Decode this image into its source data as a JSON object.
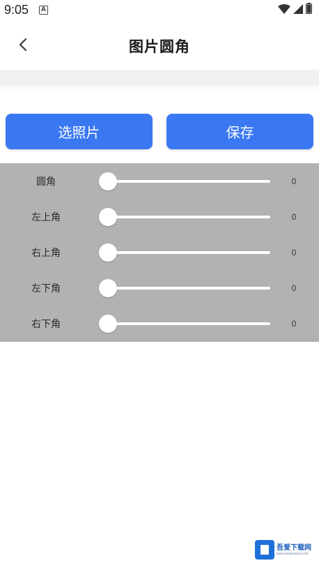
{
  "status_bar": {
    "time": "9:05",
    "notification_icon": "a-icon",
    "wifi_icon": "wifi-icon",
    "signal_icon": "signal-icon",
    "battery_icon": "battery-icon"
  },
  "header": {
    "title": "图片圆角",
    "back_icon": "chevron-left-icon"
  },
  "actions": {
    "select_photo_label": "选照片",
    "save_label": "保存",
    "button_color": "#3a78f2"
  },
  "sliders": [
    {
      "label": "圆角",
      "value": "0"
    },
    {
      "label": "左上角",
      "value": "0"
    },
    {
      "label": "右上角",
      "value": "0"
    },
    {
      "label": "左下角",
      "value": "0"
    },
    {
      "label": "右下角",
      "value": "0"
    }
  ],
  "panel_color": "#b2b2b2",
  "watermark": {
    "text": "吾爱下载网",
    "subtext": "www.wuaixiazai.com"
  }
}
